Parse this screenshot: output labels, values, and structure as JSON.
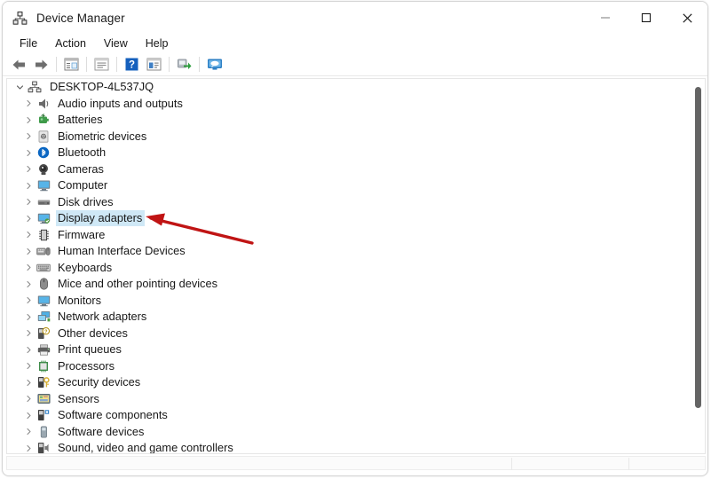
{
  "window": {
    "title": "Device Manager",
    "app_icon": "device-manager-icon",
    "controls": {
      "minimize": "minimize-icon",
      "maximize": "maximize-icon",
      "close": "close-icon"
    }
  },
  "menubar": {
    "items": [
      {
        "label": "File"
      },
      {
        "label": "Action"
      },
      {
        "label": "View"
      },
      {
        "label": "Help"
      }
    ]
  },
  "toolbar": {
    "buttons": [
      {
        "name": "back-icon",
        "tip": "Back"
      },
      {
        "name": "forward-icon",
        "tip": "Forward"
      },
      {
        "name": "show-hide-console-tree-icon",
        "tip": "Show/Hide Console Tree"
      },
      {
        "name": "properties-icon",
        "tip": "Properties"
      },
      {
        "name": "help-icon",
        "tip": "Help"
      },
      {
        "name": "update-driver-icon",
        "tip": "Update Driver Software"
      },
      {
        "name": "scan-for-hardware-changes-icon",
        "tip": "Scan for hardware changes"
      },
      {
        "name": "remote-display-icon",
        "tip": "Display"
      }
    ]
  },
  "tree": {
    "root": {
      "label": "DESKTOP-4L537JQ",
      "icon": "computer-node-icon",
      "expanded": true
    },
    "items": [
      {
        "label": "Audio inputs and outputs",
        "icon": "speaker-icon"
      },
      {
        "label": "Batteries",
        "icon": "battery-icon"
      },
      {
        "label": "Biometric devices",
        "icon": "fingerprint-icon"
      },
      {
        "label": "Bluetooth",
        "icon": "bluetooth-icon"
      },
      {
        "label": "Cameras",
        "icon": "camera-icon"
      },
      {
        "label": "Computer",
        "icon": "monitor-icon"
      },
      {
        "label": "Disk drives",
        "icon": "disk-drive-icon"
      },
      {
        "label": "Display adapters",
        "icon": "display-adapter-icon",
        "selected": true
      },
      {
        "label": "Firmware",
        "icon": "firmware-chip-icon"
      },
      {
        "label": "Human Interface Devices",
        "icon": "hid-icon"
      },
      {
        "label": "Keyboards",
        "icon": "keyboard-icon"
      },
      {
        "label": "Mice and other pointing devices",
        "icon": "mouse-icon"
      },
      {
        "label": "Monitors",
        "icon": "monitor-icon"
      },
      {
        "label": "Network adapters",
        "icon": "network-adapter-icon"
      },
      {
        "label": "Other devices",
        "icon": "unknown-device-icon"
      },
      {
        "label": "Print queues",
        "icon": "printer-icon"
      },
      {
        "label": "Processors",
        "icon": "processor-icon"
      },
      {
        "label": "Security devices",
        "icon": "security-key-icon"
      },
      {
        "label": "Sensors",
        "icon": "sensor-icon"
      },
      {
        "label": "Software components",
        "icon": "software-component-icon"
      },
      {
        "label": "Software devices",
        "icon": "software-device-icon"
      },
      {
        "label": "Sound, video and game controllers",
        "icon": "sound-controller-icon"
      }
    ]
  },
  "annotation": {
    "arrow": {
      "name": "red-arrow-annotation",
      "color": "#c01414",
      "points_at": "Display adapters"
    }
  },
  "colors": {
    "selection": "#cfe8f6",
    "accent_blue": "#0a6bc4",
    "window_bg": "#ffffff",
    "scrollbar_thumb": "#646464"
  },
  "scrollbars": {
    "vertical": {
      "name": "vertical-scrollbar"
    },
    "horizontal": {
      "name": "horizontal-scrollbar"
    }
  }
}
